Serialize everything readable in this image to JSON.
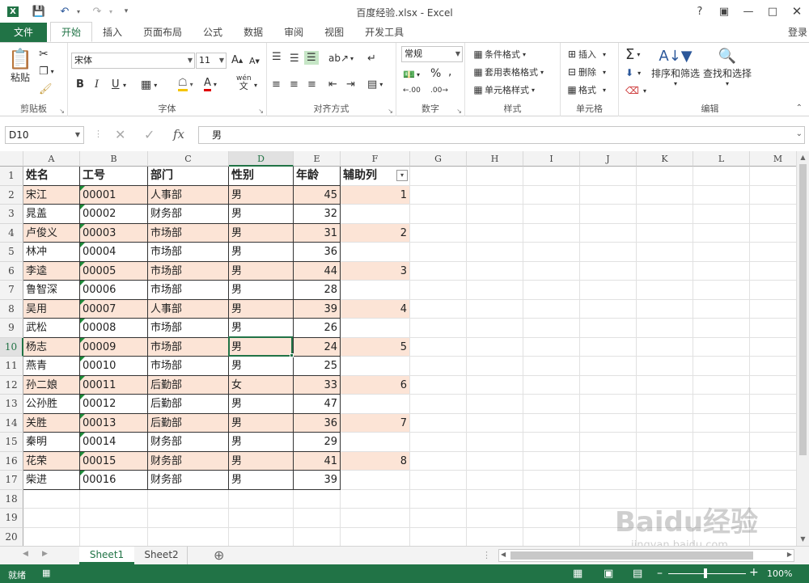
{
  "app": {
    "title": "百度经验.xlsx - Excel",
    "login": "登录"
  },
  "tabs": [
    "文件",
    "开始",
    "插入",
    "页面布局",
    "公式",
    "数据",
    "审阅",
    "视图",
    "开发工具"
  ],
  "ribbon": {
    "clipboard": {
      "label": "剪贴板",
      "paste": "粘贴"
    },
    "font": {
      "label": "字体",
      "name": "宋体",
      "size": "11",
      "bold": "B",
      "italic": "I",
      "underline": "U",
      "phonetic": "wén"
    },
    "alignment": {
      "label": "对齐方式"
    },
    "number": {
      "label": "数字",
      "format": "常规"
    },
    "styles": {
      "label": "样式",
      "conditional": "条件格式",
      "table": "套用表格格式",
      "cellstyle": "单元格样式"
    },
    "cells": {
      "label": "单元格",
      "insert": "插入",
      "delete": "删除",
      "format": "格式"
    },
    "editing": {
      "label": "编辑",
      "sort": "排序和筛选",
      "find": "查找和选择"
    }
  },
  "formula_bar": {
    "namebox": "D10",
    "fx": "fx",
    "content": "男"
  },
  "columns": [
    "A",
    "B",
    "C",
    "D",
    "E",
    "F",
    "G",
    "H",
    "I",
    "J",
    "K",
    "L",
    "M"
  ],
  "rows": [
    "1",
    "2",
    "3",
    "4",
    "5",
    "6",
    "7",
    "8",
    "9",
    "10",
    "11",
    "12",
    "13",
    "14",
    "15",
    "16",
    "17",
    "18",
    "19",
    "20"
  ],
  "headers": [
    "姓名",
    "工号",
    "部门",
    "性别",
    "年龄",
    "辅助列"
  ],
  "table": [
    [
      "宋江",
      "00001",
      "人事部",
      "男",
      "45",
      "1"
    ],
    [
      "晁盖",
      "00002",
      "财务部",
      "男",
      "32",
      ""
    ],
    [
      "卢俊义",
      "00003",
      "市场部",
      "男",
      "31",
      "2"
    ],
    [
      "林冲",
      "00004",
      "市场部",
      "男",
      "36",
      ""
    ],
    [
      "李逵",
      "00005",
      "市场部",
      "男",
      "44",
      "3"
    ],
    [
      "鲁智深",
      "00006",
      "市场部",
      "男",
      "28",
      ""
    ],
    [
      "吴用",
      "00007",
      "人事部",
      "男",
      "39",
      "4"
    ],
    [
      "武松",
      "00008",
      "市场部",
      "男",
      "26",
      ""
    ],
    [
      "杨志",
      "00009",
      "市场部",
      "男",
      "24",
      "5"
    ],
    [
      "燕青",
      "00010",
      "市场部",
      "男",
      "25",
      ""
    ],
    [
      "孙二娘",
      "00011",
      "后勤部",
      "女",
      "33",
      "6"
    ],
    [
      "公孙胜",
      "00012",
      "后勤部",
      "男",
      "47",
      ""
    ],
    [
      "关胜",
      "00013",
      "后勤部",
      "男",
      "36",
      "7"
    ],
    [
      "秦明",
      "00014",
      "财务部",
      "男",
      "29",
      ""
    ],
    [
      "花荣",
      "00015",
      "财务部",
      "男",
      "41",
      "8"
    ],
    [
      "柴进",
      "00016",
      "财务部",
      "男",
      "39",
      ""
    ]
  ],
  "sheets": [
    "Sheet1",
    "Sheet2"
  ],
  "status": {
    "ready": "就绪",
    "zoom": "100%"
  },
  "watermark": {
    "brand": "Baidu经验",
    "url": "jingyan.baidu.com"
  },
  "colors": {
    "accent": "#217346",
    "band": "#fce4d6"
  }
}
